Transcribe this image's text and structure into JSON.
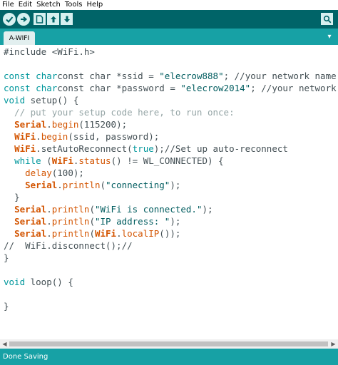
{
  "menu": [
    "File",
    "Edit",
    "Sketch",
    "Tools",
    "Help"
  ],
  "toolbar": {
    "buttons": [
      {
        "icon": "verify-icon"
      },
      {
        "icon": "upload-icon"
      },
      {
        "icon": "new-icon"
      },
      {
        "icon": "open-icon"
      },
      {
        "icon": "save-icon"
      },
      {
        "icon": "serial-monitor-icon"
      }
    ]
  },
  "tab": {
    "label": "A-WIFI",
    "menu_icon": "▾"
  },
  "code": {
    "l1": {
      "a": "#include <WiFi.h>"
    },
    "l3": {
      "a": "const char *ssid = ",
      "s": "\"elecrow888\"",
      "c": "; //your network name"
    },
    "l4": {
      "a": "const char *password = ",
      "s": "\"elecrow2014\"",
      "c": "; //your network password"
    },
    "l5": {
      "k": "void",
      "a": " setup() {"
    },
    "l6": {
      "c": "  // put your setup code here, to run once:"
    },
    "l7": {
      "o": "Serial",
      "d": ".",
      "f": "begin",
      "a": "(115200);"
    },
    "l8": {
      "o": "WiFi",
      "d": ".",
      "f": "begin",
      "a": "(ssid, password);"
    },
    "l9": {
      "o": "WiFi",
      "d": ".",
      "a": "setAutoReconnect(",
      "k": "true",
      "c": ");//Set up auto-reconnect"
    },
    "l10": {
      "k": "while",
      "a": " (",
      "o": "WiFi",
      "d": ".",
      "f": "status",
      "b": "() != WL_CONNECTED) {"
    },
    "l11": {
      "f": "delay",
      "a": "(100);"
    },
    "l12": {
      "o": "Serial",
      "d": ".",
      "f": "println",
      "a": "(",
      "s": "\"connecting\"",
      "b": ");"
    },
    "l13": {
      "a": "}"
    },
    "l14": {
      "o": "Serial",
      "d": ".",
      "f": "println",
      "a": "(",
      "s": "\"WiFi is connected.\"",
      "b": ");"
    },
    "l15": {
      "o": "Serial",
      "d": ".",
      "f": "println",
      "a": "(",
      "s": "\"IP address: \"",
      "b": ");"
    },
    "l16": {
      "o": "Serial",
      "d": ".",
      "f": "println",
      "a": "(",
      "o2": "WiFi",
      "d2": ".",
      "f2": "localIP",
      "b": "());"
    },
    "l17": {
      "a": "//  WiFi.disconnect();//"
    },
    "l18": {
      "a": "}"
    },
    "l20": {
      "k": "void",
      "a": " loop() {"
    },
    "l22": {
      "a": "}"
    }
  },
  "hscroll": {
    "left": "◀",
    "right": "▶"
  },
  "status": "Done Saving",
  "colors": {
    "toolbar": "#006468",
    "tabbar": "#17a1a5",
    "keyword": "#00979c",
    "function": "#d35400",
    "comment": "#95a5a6"
  }
}
